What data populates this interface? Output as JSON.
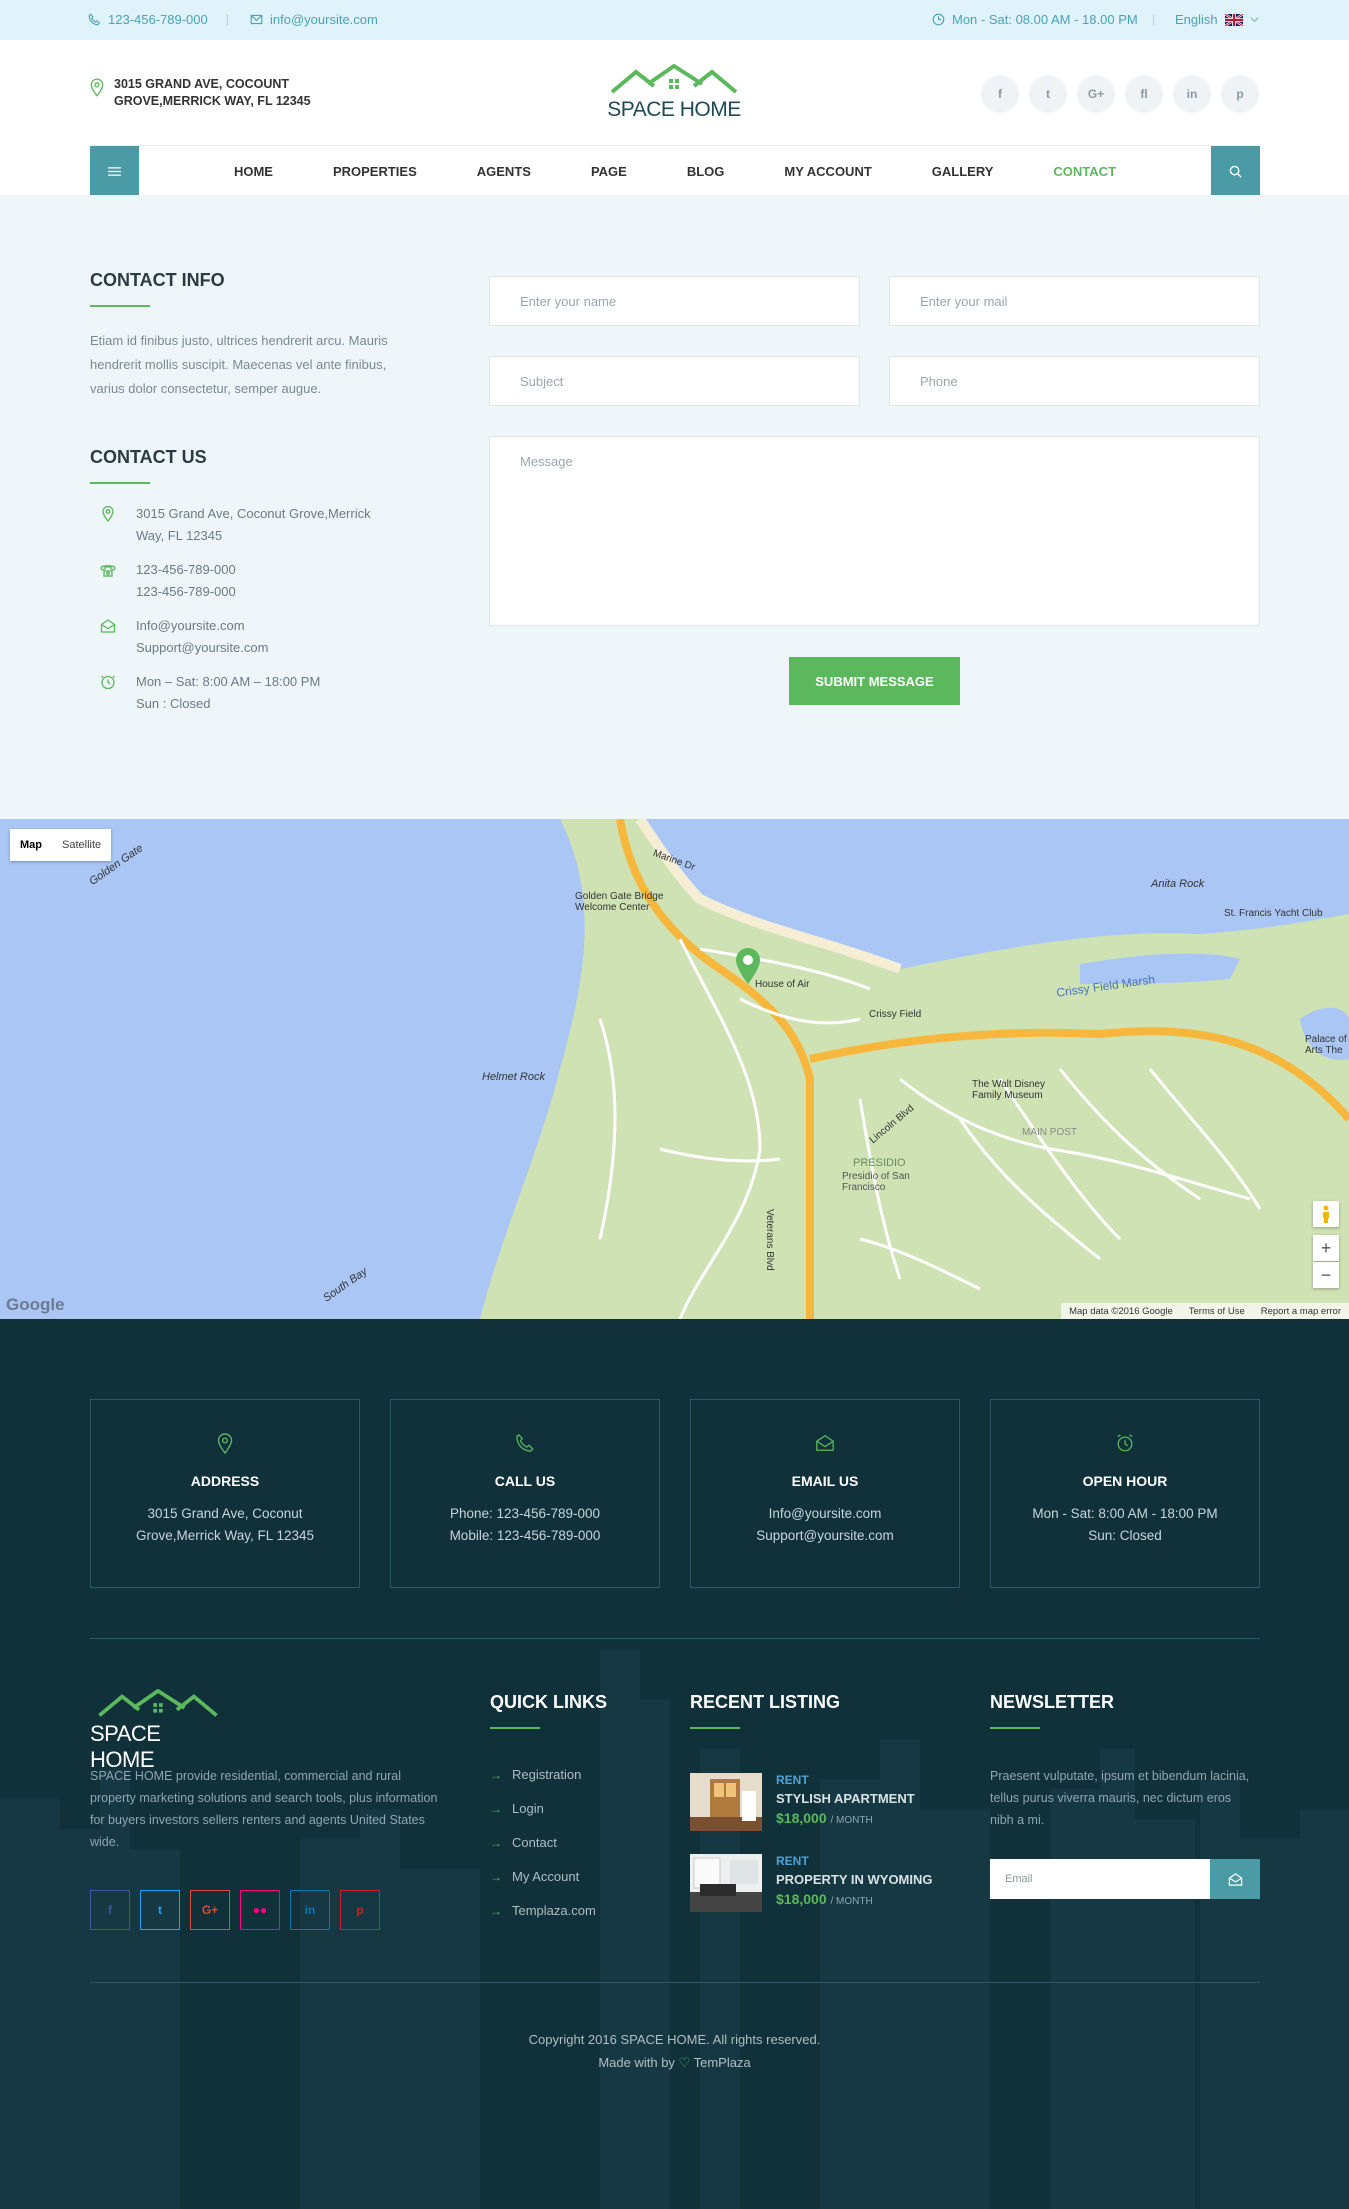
{
  "topbar": {
    "phone": "123-456-789-000",
    "email": "info@yoursite.com",
    "hours": "Mon - Sat: 08.00 AM - 18.00 PM",
    "language": "English"
  },
  "header": {
    "address_line1": "3015 GRAND AVE, COCOUNT",
    "address_line2": "GROVE,MERRICK WAY, FL 12345",
    "logo_text": "SPACE HOME",
    "socials": [
      "f",
      "t",
      "G+",
      "fl",
      "in",
      "p"
    ]
  },
  "nav": {
    "items": [
      "HOME",
      "PROPERTIES",
      "AGENTS",
      "PAGE",
      "BLOG",
      "MY ACCOUNT",
      "GALLERY",
      "CONTACT"
    ],
    "active": "CONTACT"
  },
  "contact_info": {
    "title": "CONTACT INFO",
    "text": "Etiam id finibus justo, ultrices hendrerit arcu. Mauris hendrerit mollis suscipit. Maecenas vel ante finibus, varius dolor consectetur, semper augue."
  },
  "contact_us": {
    "title": "CONTACT US",
    "address_1": "3015 Grand Ave, Coconut Grove,Merrick",
    "address_2": "Way, FL 12345",
    "phone_1": "123-456-789-000",
    "phone_2": "123-456-789-000",
    "email_1": "Info@yoursite.com",
    "email_2": "Support@yoursite.com",
    "hours_1": "Mon – Sat: 8:00 AM – 18:00 PM",
    "hours_2": "Sun : Closed"
  },
  "form": {
    "name_placeholder": "Enter your name",
    "mail_placeholder": "Enter your mail",
    "subject_placeholder": "Subject",
    "phone_placeholder": "Phone",
    "message_placeholder": "Message",
    "submit_label": "SUBMIT MESSAGE"
  },
  "map": {
    "type_map": "Map",
    "type_satellite": "Satellite",
    "labels": {
      "golden_gate": "Golden Gate",
      "anita_rock": "Anita Rock",
      "yacht_club": "St. Francis Yacht Club",
      "helmet_rock": "Helmet Rock",
      "south_bay": "South Bay",
      "crissy_marsh": "Crissy Field Marsh",
      "presidio": "PRESIDIO",
      "presidio_sf": "Presidio of San Francisco",
      "main_post": "MAIN POST",
      "bridge_center": "Golden Gate Bridge Welcome Center",
      "house_of_air": "House of Air",
      "crissy_field": "Crissy Field",
      "disney_museum": "The Walt Disney Family Museum",
      "palace": "Palace of Arts The",
      "veterans": "Veterans Blvd",
      "lincoln": "Lincoln Blvd",
      "marine_dr": "Marine Dr"
    },
    "google": "Google",
    "attribution": [
      "Map data ©2016 Google",
      "Terms of Use",
      "Report a map error"
    ]
  },
  "footer_boxes": [
    {
      "title": "ADDRESS",
      "line1": "3015 Grand Ave, Coconut",
      "line2": "Grove,Merrick Way, FL 12345"
    },
    {
      "title": "CALL US",
      "line1": "Phone: 123-456-789-000",
      "line2": "Mobile: 123-456-789-000"
    },
    {
      "title": "EMAIL US",
      "line1": "Info@yoursite.com",
      "line2": "Support@yoursite.com"
    },
    {
      "title": "OPEN HOUR",
      "line1": "Mon - Sat: 8:00 AM - 18:00 PM",
      "line2": "Sun: Closed"
    }
  ],
  "footer": {
    "logo_text": "SPACE HOME",
    "about": "SPACE HOME provide residential, commercial and rural property marketing solutions and search tools, plus information for buyers investors sellers renters and agents United States wide.",
    "quick_links_title": "QUICK LINKS",
    "quick_links": [
      "Registration",
      "Login",
      "Contact",
      "My Account",
      "Templaza.com"
    ],
    "recent_title": "RECENT LISTING",
    "listings": [
      {
        "type": "RENT",
        "title": "STYLISH APARTMENT",
        "price": "$18,000",
        "unit": "/ MONTH"
      },
      {
        "type": "RENT",
        "title": "PROPERTY IN WYOMING",
        "price": "$18,000",
        "unit": "/ MONTH"
      }
    ],
    "newsletter_title": "NEWSLETTER",
    "newsletter_text": "Praesent vulputate, ipsum et bibendum lacinia, tellus purus viverra mauris, nec dictum eros nibh a mi.",
    "email_placeholder": "Email",
    "copyright": "Copyright 2016 SPACE HOME. All rights reserved.",
    "made_with_prefix": "Made with by",
    "made_with_brand": "TemPlaza"
  },
  "colors": {
    "accent_green": "#5cb85c",
    "teal": "#4a9ba6",
    "footer_bg": "#10303a",
    "contact_bg": "#eef6fa",
    "topbar_bg": "#e0f2fa",
    "facebook": "#3b5998",
    "twitter": "#1da1f2",
    "google_plus": "#dd4b39",
    "flickr": "#ff0084",
    "linkedin": "#0077b5",
    "pinterest": "#cb2027"
  }
}
